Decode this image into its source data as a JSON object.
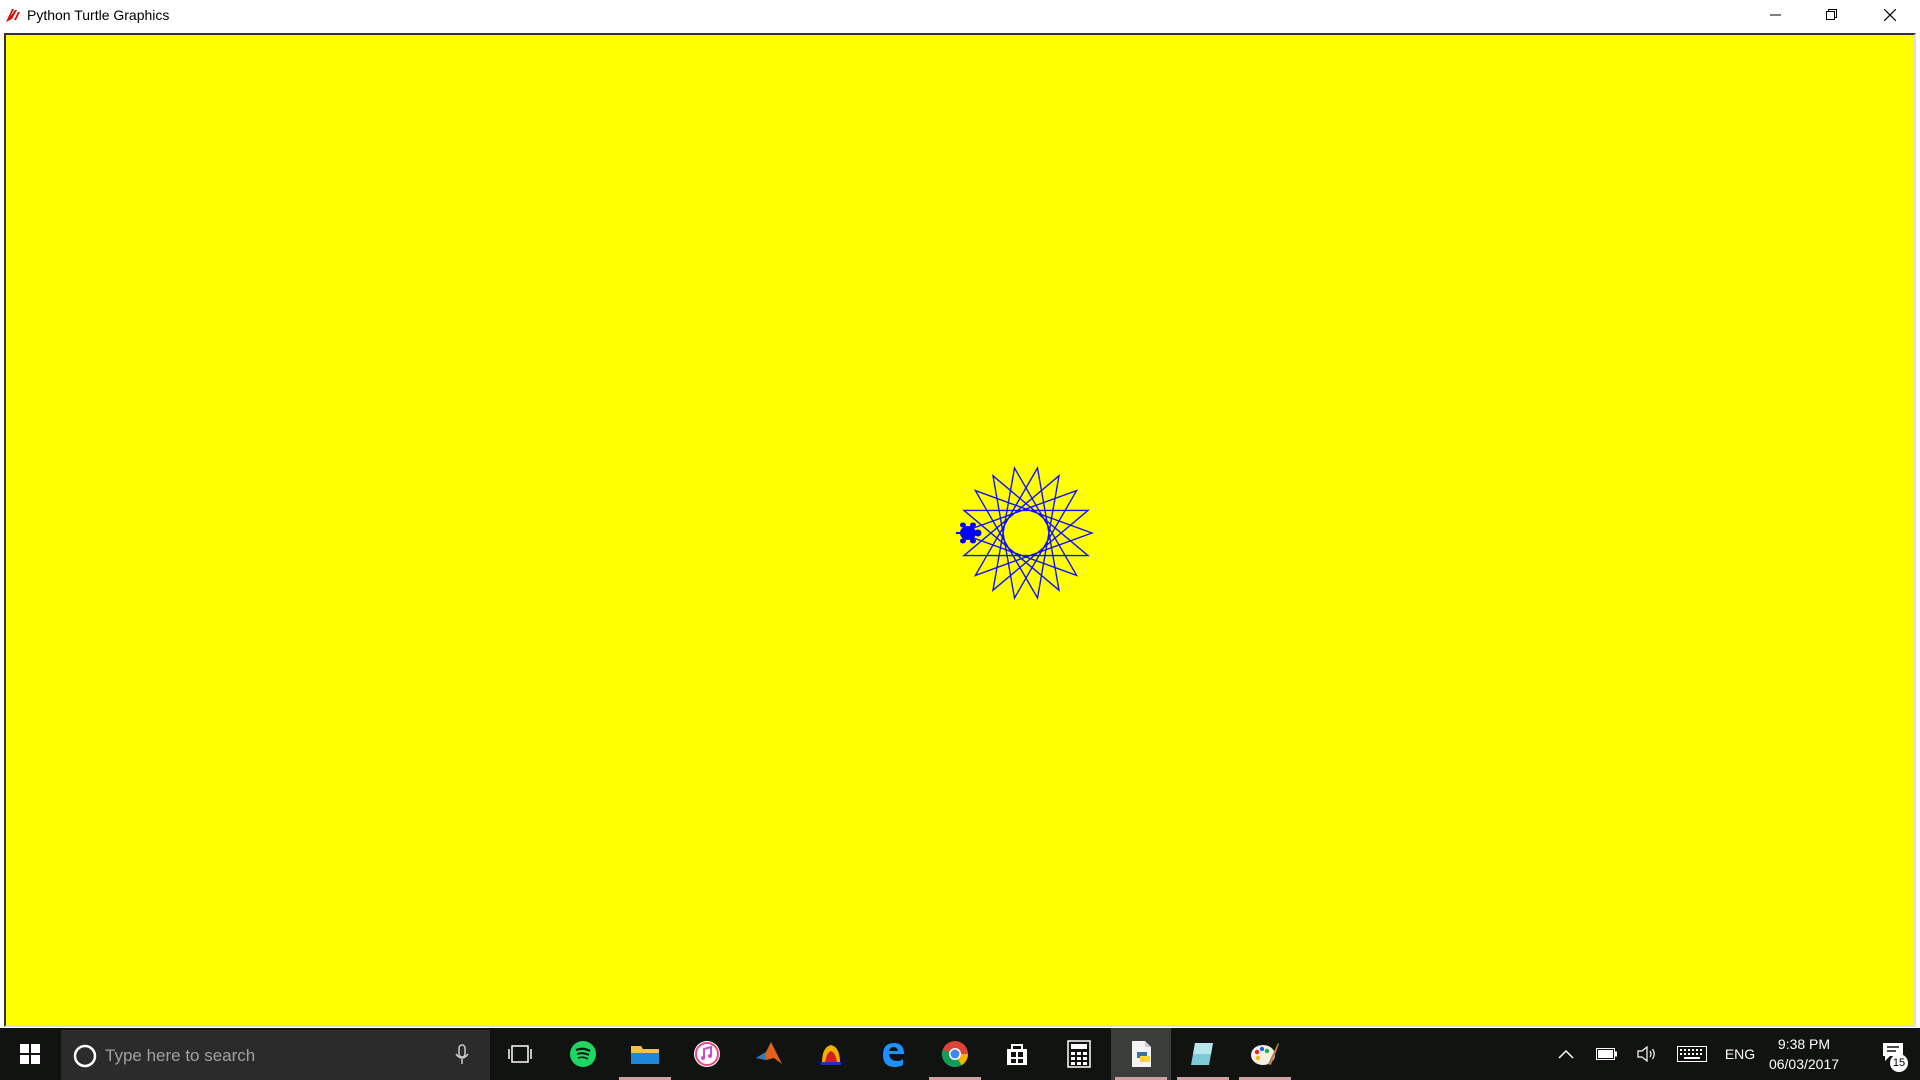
{
  "window": {
    "title": "Python Turtle Graphics",
    "controls": {
      "minimize": "minimize",
      "restore": "restore",
      "close": "close"
    }
  },
  "canvas": {
    "background": "#ffff00",
    "pen_color": "#1010ff",
    "turtle_color": "#0000ff",
    "drawing": "star polygon"
  },
  "taskbar": {
    "search": {
      "placeholder": "Type here to search"
    },
    "apps": [
      {
        "name": "task-view",
        "icon": "task-view-icon"
      },
      {
        "name": "spotify",
        "icon": "spotify-icon"
      },
      {
        "name": "file-explorer",
        "icon": "folder-icon"
      },
      {
        "name": "itunes",
        "icon": "itunes-icon"
      },
      {
        "name": "matlab",
        "icon": "matlab-icon"
      },
      {
        "name": "app",
        "icon": "app-icon"
      },
      {
        "name": "edge",
        "icon": "edge-icon"
      },
      {
        "name": "chrome",
        "icon": "chrome-icon"
      },
      {
        "name": "store",
        "icon": "store-icon"
      },
      {
        "name": "calculator",
        "icon": "calculator-icon"
      },
      {
        "name": "python-editor",
        "icon": "python-file-icon"
      },
      {
        "name": "paint-3d",
        "icon": "paint-3d-icon"
      },
      {
        "name": "paint",
        "icon": "paint-icon"
      }
    ],
    "tray": {
      "language": "ENG",
      "time": "9:38 PM",
      "date": "06/03/2017",
      "notifications": "15"
    }
  }
}
